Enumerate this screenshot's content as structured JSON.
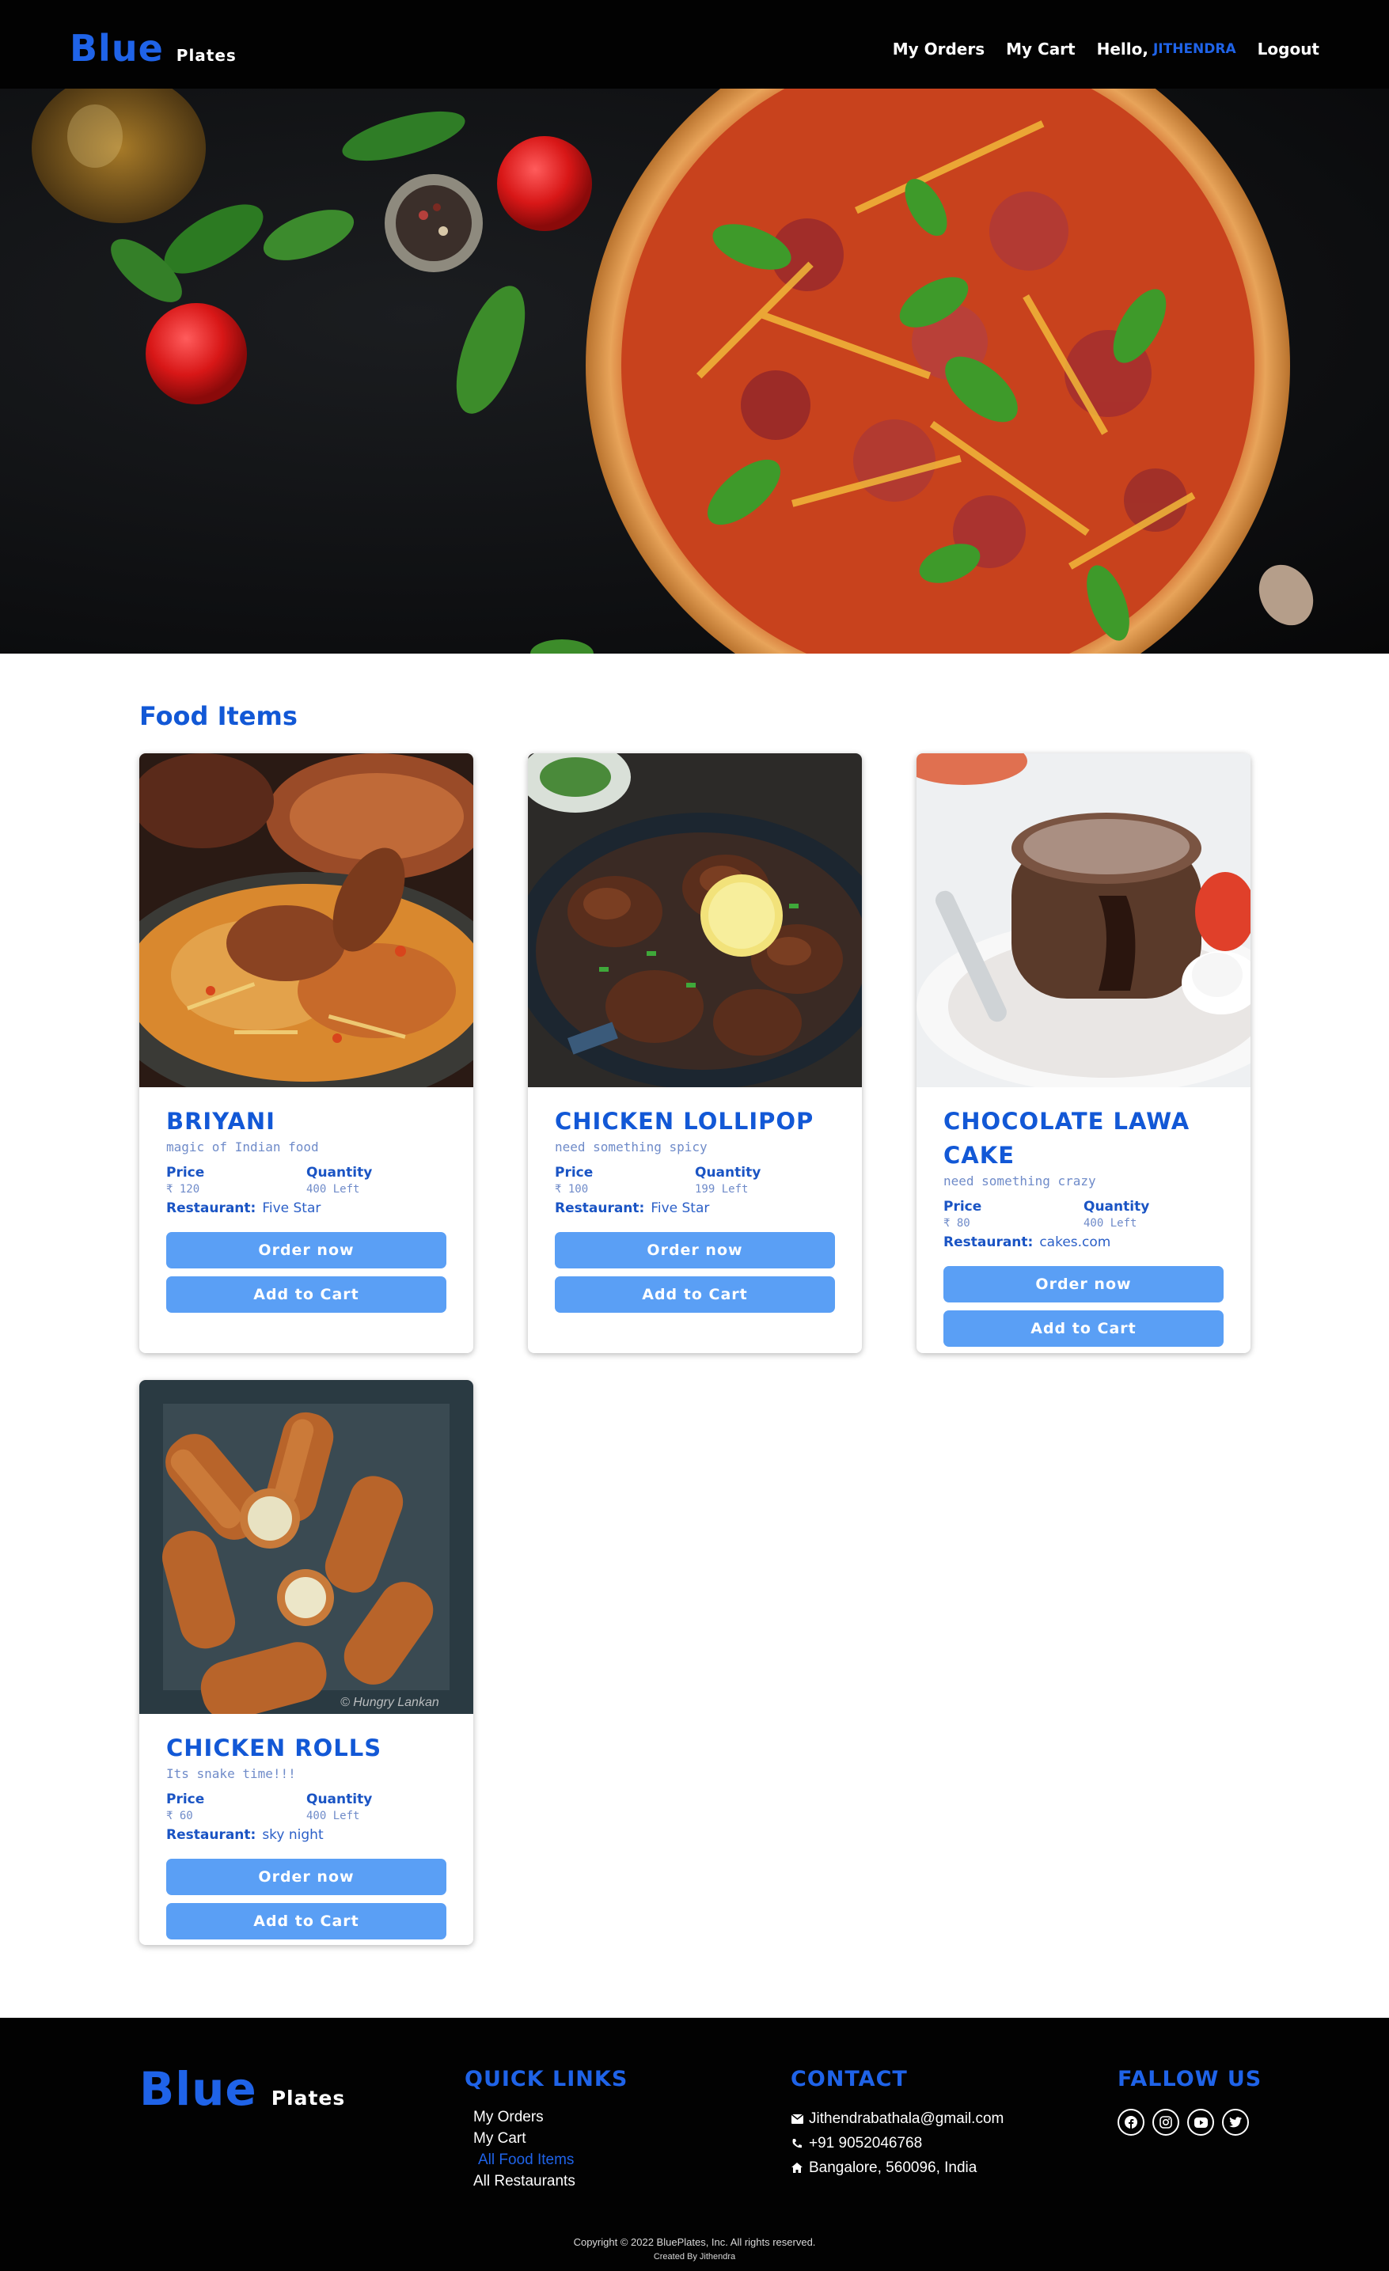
{
  "nav": {
    "brand_main": "Blue",
    "brand_sub": "Plates",
    "links": [
      "My Orders",
      "My Cart"
    ],
    "hello": "Hello,",
    "user": "JITHENDRA",
    "logout": "Logout"
  },
  "section": {
    "title": "Food Items"
  },
  "items": [
    {
      "name": "BRIYANI",
      "tagline": "magic of Indian food",
      "price_label": "Price",
      "price": "₹ 120",
      "qty_label": "Quantity",
      "qty": "400 Left",
      "rest_label": "Restaurant:",
      "restaurant": "Five Star",
      "order": "Order now",
      "cart": "Add to Cart"
    },
    {
      "name": "CHICKEN LOLLIPOP",
      "tagline": "need something spicy",
      "price_label": "Price",
      "price": "₹ 100",
      "qty_label": "Quantity",
      "qty": "199 Left",
      "rest_label": "Restaurant:",
      "restaurant": "Five Star",
      "order": "Order now",
      "cart": "Add to Cart"
    },
    {
      "name": "CHOCOLATE LAWA CAKE",
      "tagline": "need something crazy",
      "price_label": "Price",
      "price": "₹ 80",
      "qty_label": "Quantity",
      "qty": "400 Left",
      "rest_label": "Restaurant:",
      "restaurant": "cakes.com",
      "order": "Order now",
      "cart": "Add to Cart"
    },
    {
      "name": "CHICKEN ROLLS",
      "tagline": "Its snake time!!!",
      "price_label": "Price",
      "price": "₹ 60",
      "qty_label": "Quantity",
      "qty": "400 Left",
      "rest_label": "Restaurant:",
      "restaurant": "sky night",
      "order": "Order now",
      "cart": "Add to Cart"
    }
  ],
  "image_watermark": "© Hungry Lankan",
  "footer": {
    "brand_main": "Blue",
    "brand_sub": "Plates",
    "quick_links_title": "QUICK LINKS",
    "quick_links": [
      "My Orders",
      "My Cart",
      "All Food Items",
      "All Restaurants"
    ],
    "contact_title": "CONTACT",
    "email": "Jithendrabathala@gmail.com",
    "phone": "+91 9052046768",
    "address": "Bangalore, 560096, India",
    "follow_title": "FALLOW US",
    "socials": [
      "facebook-icon",
      "instagram-icon",
      "youtube-icon",
      "twitter-icon"
    ],
    "copyright": "Copyright © 2022 BluePlates, Inc. All rights reserved.",
    "created_by": "Created By Jithendra"
  },
  "colors": {
    "brand_blue": "#1f63e8",
    "button_blue": "#5a9ff5",
    "title_blue": "#1258d6",
    "dark": "#020202"
  }
}
